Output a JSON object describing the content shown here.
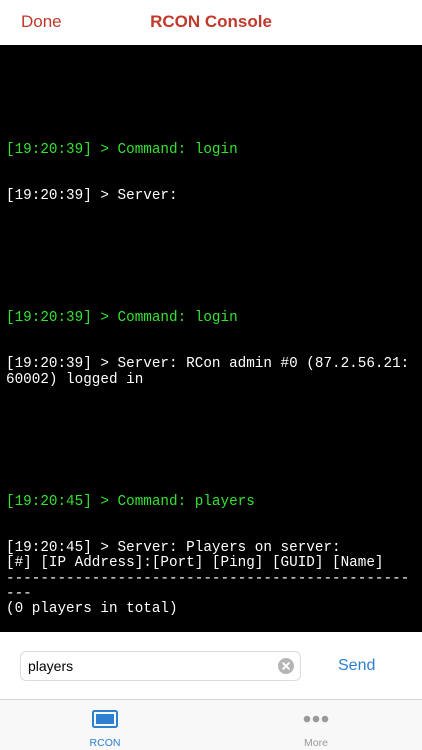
{
  "navbar": {
    "done_label": "Done",
    "title": "RCON Console"
  },
  "console": {
    "entries": [
      {
        "command": "[19:20:39] > Command: login",
        "response": "[19:20:39] > Server:"
      },
      {
        "command": "[19:20:39] > Command: login",
        "response": "[19:20:39] > Server: RCon admin #0 (87.2.56.21:60002) logged in"
      },
      {
        "command": "[19:20:45] > Command: players",
        "response": "[19:20:45] > Server: Players on server:\n[#] [IP Address]:[Port] [Ping] [GUID] [Name]\n--------------------------------------------------\n(0 players in total)"
      }
    ]
  },
  "input": {
    "value": "players",
    "send_label": "Send"
  },
  "tabbar": {
    "tabs": [
      {
        "label": "RCON",
        "icon": "monitor-icon",
        "active": true
      },
      {
        "label": "More",
        "icon": "more-dots-icon",
        "active": false
      }
    ]
  },
  "colors": {
    "accent_red": "#c0392b",
    "accent_blue": "#2d7fd1",
    "console_bg": "#000000",
    "command_green": "#33e233",
    "server_white": "#ffffff"
  }
}
